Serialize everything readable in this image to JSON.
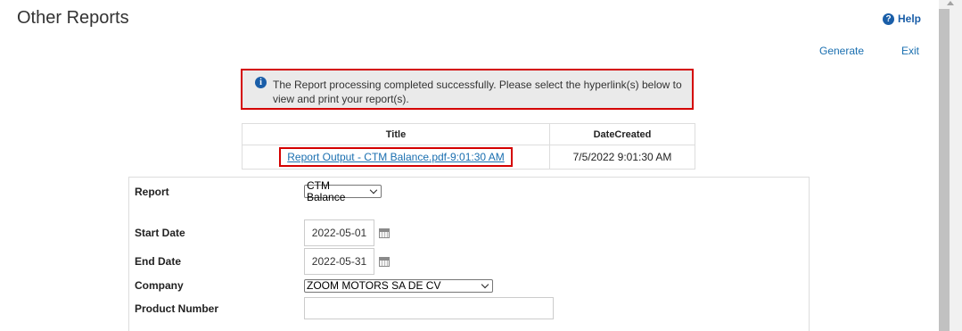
{
  "header": {
    "title": "Other Reports",
    "help_label": "Help"
  },
  "toolbar": {
    "generate_label": "Generate",
    "exit_label": "Exit"
  },
  "alert": {
    "message": "The Report processing completed successfully. Please select the hyperlink(s) below to view and print your report(s)."
  },
  "reports_table": {
    "columns": [
      "Title",
      "DateCreated"
    ],
    "rows": [
      {
        "title": "Report Output - CTM Balance.pdf-9:01:30 AM",
        "date_created": "7/5/2022 9:01:30 AM"
      }
    ]
  },
  "form": {
    "report": {
      "label": "Report",
      "value": "CTM Balance"
    },
    "start_date": {
      "label": "Start Date",
      "value": "2022-05-01"
    },
    "end_date": {
      "label": "End Date",
      "value": "2022-05-31"
    },
    "company": {
      "label": "Company",
      "value": "ZOOM MOTORS SA DE CV"
    },
    "product_number": {
      "label": "Product Number",
      "value": ""
    }
  },
  "colors": {
    "link": "#1a6fb0",
    "highlight_border": "#d40000",
    "alert_bg": "#eaeaea",
    "info_icon": "#1a5ea8"
  },
  "icons": [
    "help-icon",
    "info-icon",
    "calendar-icon",
    "chevron-down-icon"
  ]
}
